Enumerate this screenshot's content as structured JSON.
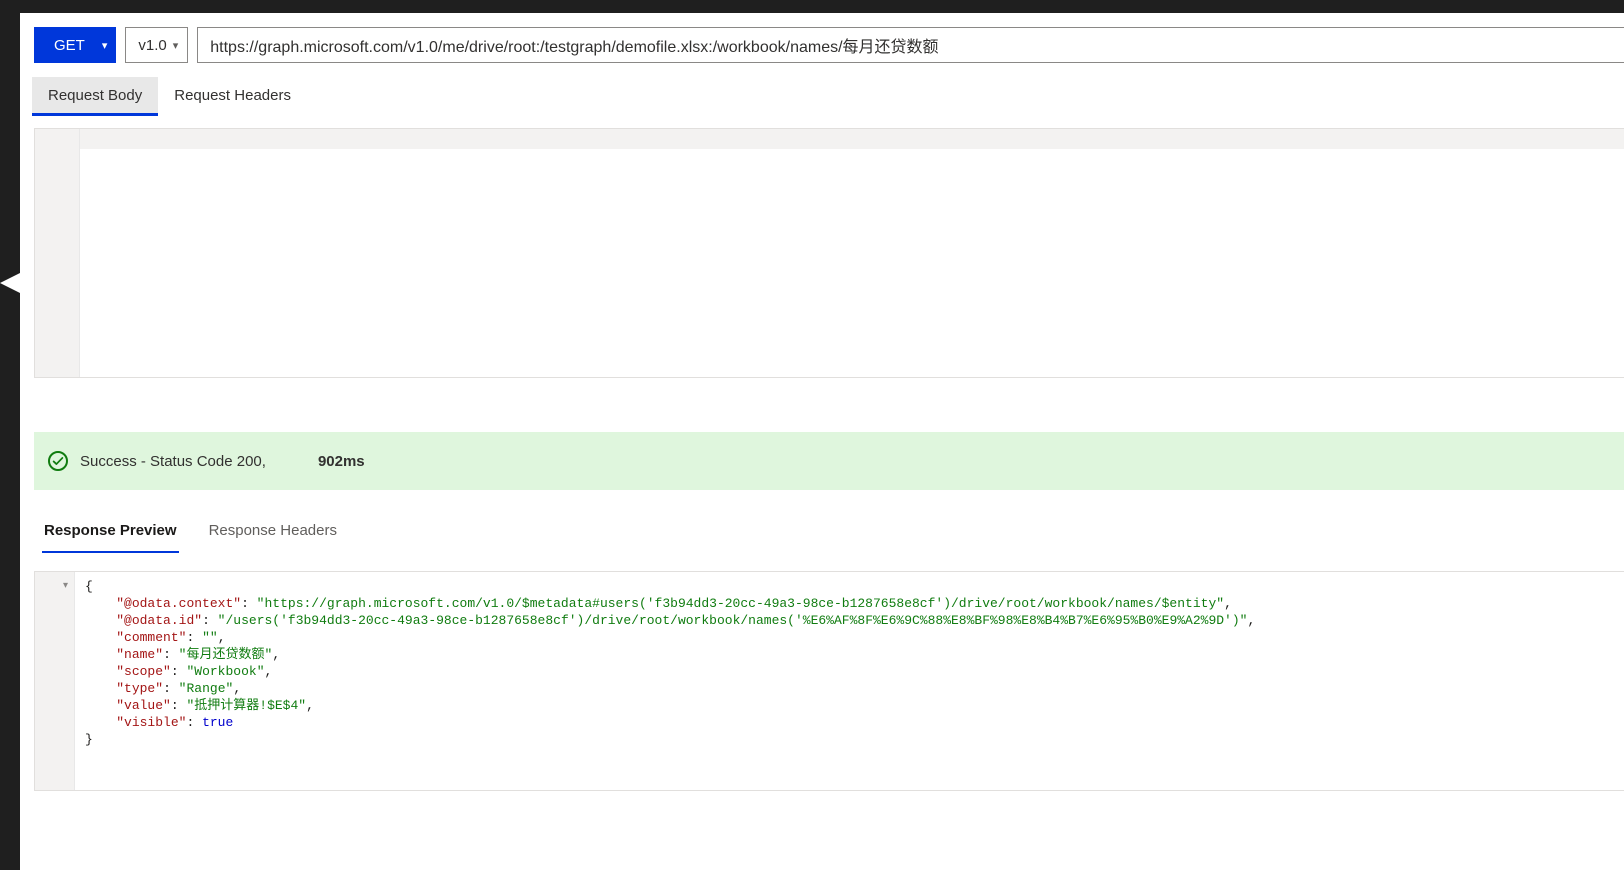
{
  "query": {
    "method": "GET",
    "version": "v1.0",
    "url": "https://graph.microsoft.com/v1.0/me/drive/root:/testgraph/demofile.xlsx:/workbook/names/每月还贷数额"
  },
  "request_tabs": {
    "body": "Request Body",
    "headers": "Request Headers"
  },
  "status": {
    "text": "Success - Status Code 200,",
    "duration": "902ms"
  },
  "response_tabs": {
    "preview": "Response Preview",
    "headers": "Response Headers"
  },
  "response_json": {
    "odata_context_key": "@odata.context",
    "odata_context_val": "https://graph.microsoft.com/v1.0/$metadata#users('f3b94dd3-20cc-49a3-98ce-b1287658e8cf')/drive/root/workbook/names/$entity",
    "odata_id_key": "@odata.id",
    "odata_id_val": "/users('f3b94dd3-20cc-49a3-98ce-b1287658e8cf')/drive/root/workbook/names('%E6%AF%8F%E6%9C%88%E8%BF%98%E8%B4%B7%E6%95%B0%E9%A2%9D')",
    "comment_key": "comment",
    "comment_val": "",
    "name_key": "name",
    "name_val": "每月还贷数额",
    "scope_key": "scope",
    "scope_val": "Workbook",
    "type_key": "type",
    "type_val": "Range",
    "value_key": "value",
    "value_val": "抵押计算器!$E$4",
    "visible_key": "visible",
    "visible_val": "true"
  }
}
